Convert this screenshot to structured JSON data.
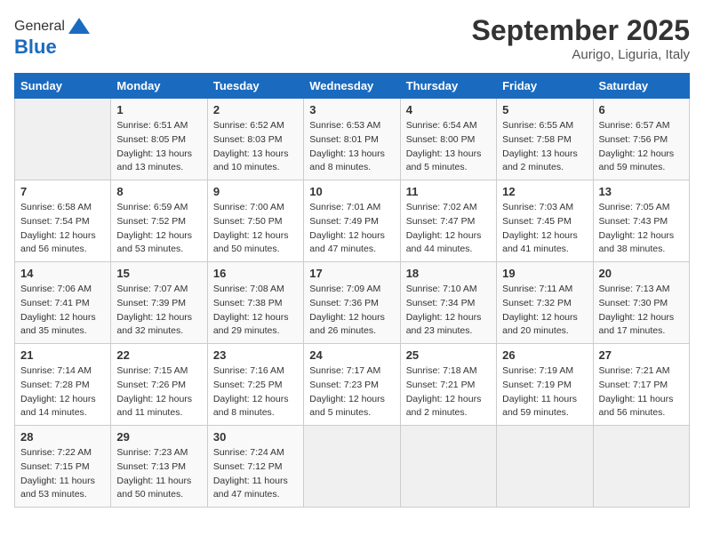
{
  "header": {
    "logo": {
      "general": "General",
      "blue": "Blue"
    },
    "title": "September 2025",
    "location": "Aurigo, Liguria, Italy"
  },
  "calendar": {
    "days_of_week": [
      "Sunday",
      "Monday",
      "Tuesday",
      "Wednesday",
      "Thursday",
      "Friday",
      "Saturday"
    ],
    "weeks": [
      [
        {
          "day": "",
          "info": ""
        },
        {
          "day": "1",
          "info": "Sunrise: 6:51 AM\nSunset: 8:05 PM\nDaylight: 13 hours\nand 13 minutes."
        },
        {
          "day": "2",
          "info": "Sunrise: 6:52 AM\nSunset: 8:03 PM\nDaylight: 13 hours\nand 10 minutes."
        },
        {
          "day": "3",
          "info": "Sunrise: 6:53 AM\nSunset: 8:01 PM\nDaylight: 13 hours\nand 8 minutes."
        },
        {
          "day": "4",
          "info": "Sunrise: 6:54 AM\nSunset: 8:00 PM\nDaylight: 13 hours\nand 5 minutes."
        },
        {
          "day": "5",
          "info": "Sunrise: 6:55 AM\nSunset: 7:58 PM\nDaylight: 13 hours\nand 2 minutes."
        },
        {
          "day": "6",
          "info": "Sunrise: 6:57 AM\nSunset: 7:56 PM\nDaylight: 12 hours\nand 59 minutes."
        }
      ],
      [
        {
          "day": "7",
          "info": "Sunrise: 6:58 AM\nSunset: 7:54 PM\nDaylight: 12 hours\nand 56 minutes."
        },
        {
          "day": "8",
          "info": "Sunrise: 6:59 AM\nSunset: 7:52 PM\nDaylight: 12 hours\nand 53 minutes."
        },
        {
          "day": "9",
          "info": "Sunrise: 7:00 AM\nSunset: 7:50 PM\nDaylight: 12 hours\nand 50 minutes."
        },
        {
          "day": "10",
          "info": "Sunrise: 7:01 AM\nSunset: 7:49 PM\nDaylight: 12 hours\nand 47 minutes."
        },
        {
          "day": "11",
          "info": "Sunrise: 7:02 AM\nSunset: 7:47 PM\nDaylight: 12 hours\nand 44 minutes."
        },
        {
          "day": "12",
          "info": "Sunrise: 7:03 AM\nSunset: 7:45 PM\nDaylight: 12 hours\nand 41 minutes."
        },
        {
          "day": "13",
          "info": "Sunrise: 7:05 AM\nSunset: 7:43 PM\nDaylight: 12 hours\nand 38 minutes."
        }
      ],
      [
        {
          "day": "14",
          "info": "Sunrise: 7:06 AM\nSunset: 7:41 PM\nDaylight: 12 hours\nand 35 minutes."
        },
        {
          "day": "15",
          "info": "Sunrise: 7:07 AM\nSunset: 7:39 PM\nDaylight: 12 hours\nand 32 minutes."
        },
        {
          "day": "16",
          "info": "Sunrise: 7:08 AM\nSunset: 7:38 PM\nDaylight: 12 hours\nand 29 minutes."
        },
        {
          "day": "17",
          "info": "Sunrise: 7:09 AM\nSunset: 7:36 PM\nDaylight: 12 hours\nand 26 minutes."
        },
        {
          "day": "18",
          "info": "Sunrise: 7:10 AM\nSunset: 7:34 PM\nDaylight: 12 hours\nand 23 minutes."
        },
        {
          "day": "19",
          "info": "Sunrise: 7:11 AM\nSunset: 7:32 PM\nDaylight: 12 hours\nand 20 minutes."
        },
        {
          "day": "20",
          "info": "Sunrise: 7:13 AM\nSunset: 7:30 PM\nDaylight: 12 hours\nand 17 minutes."
        }
      ],
      [
        {
          "day": "21",
          "info": "Sunrise: 7:14 AM\nSunset: 7:28 PM\nDaylight: 12 hours\nand 14 minutes."
        },
        {
          "day": "22",
          "info": "Sunrise: 7:15 AM\nSunset: 7:26 PM\nDaylight: 12 hours\nand 11 minutes."
        },
        {
          "day": "23",
          "info": "Sunrise: 7:16 AM\nSunset: 7:25 PM\nDaylight: 12 hours\nand 8 minutes."
        },
        {
          "day": "24",
          "info": "Sunrise: 7:17 AM\nSunset: 7:23 PM\nDaylight: 12 hours\nand 5 minutes."
        },
        {
          "day": "25",
          "info": "Sunrise: 7:18 AM\nSunset: 7:21 PM\nDaylight: 12 hours\nand 2 minutes."
        },
        {
          "day": "26",
          "info": "Sunrise: 7:19 AM\nSunset: 7:19 PM\nDaylight: 11 hours\nand 59 minutes."
        },
        {
          "day": "27",
          "info": "Sunrise: 7:21 AM\nSunset: 7:17 PM\nDaylight: 11 hours\nand 56 minutes."
        }
      ],
      [
        {
          "day": "28",
          "info": "Sunrise: 7:22 AM\nSunset: 7:15 PM\nDaylight: 11 hours\nand 53 minutes."
        },
        {
          "day": "29",
          "info": "Sunrise: 7:23 AM\nSunset: 7:13 PM\nDaylight: 11 hours\nand 50 minutes."
        },
        {
          "day": "30",
          "info": "Sunrise: 7:24 AM\nSunset: 7:12 PM\nDaylight: 11 hours\nand 47 minutes."
        },
        {
          "day": "",
          "info": ""
        },
        {
          "day": "",
          "info": ""
        },
        {
          "day": "",
          "info": ""
        },
        {
          "day": "",
          "info": ""
        }
      ]
    ]
  }
}
